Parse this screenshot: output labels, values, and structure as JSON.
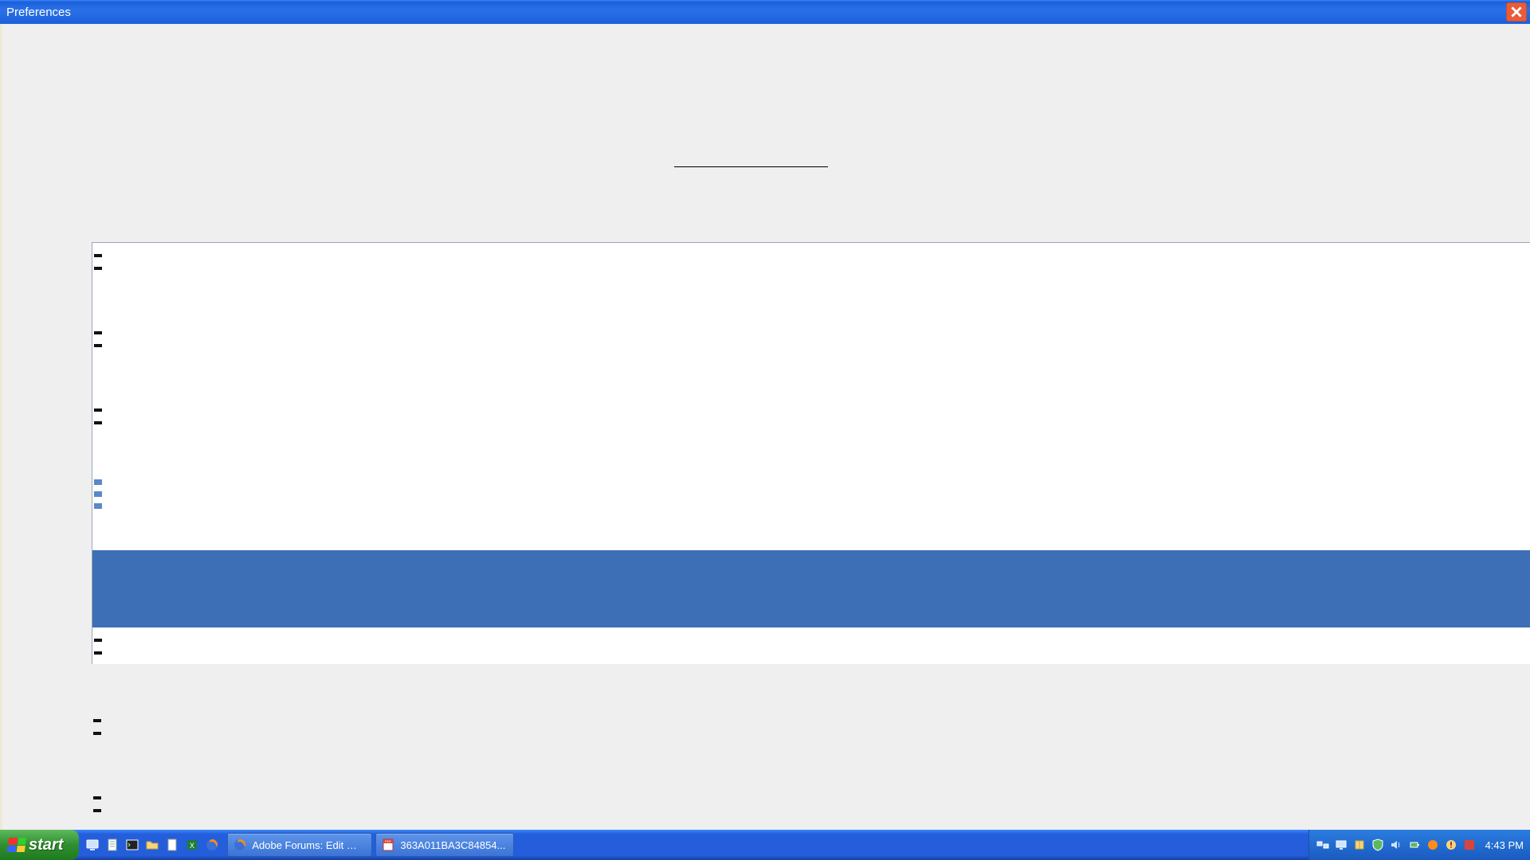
{
  "window": {
    "title": "Preferences"
  },
  "listbox": {
    "items": [
      {
        "label": ""
      },
      {
        "label": ""
      },
      {
        "label": ""
      },
      {
        "label": "",
        "selected": true
      },
      {
        "label": ""
      },
      {
        "label": ""
      },
      {
        "label": ""
      }
    ]
  },
  "taskbar": {
    "start_label": "start",
    "tasks": [
      {
        "label": "Adobe Forums: Edit M...",
        "icon": "firefox"
      },
      {
        "label": "363A011BA3C84854...",
        "icon": "pdf"
      }
    ],
    "clock": "4:43 PM"
  }
}
